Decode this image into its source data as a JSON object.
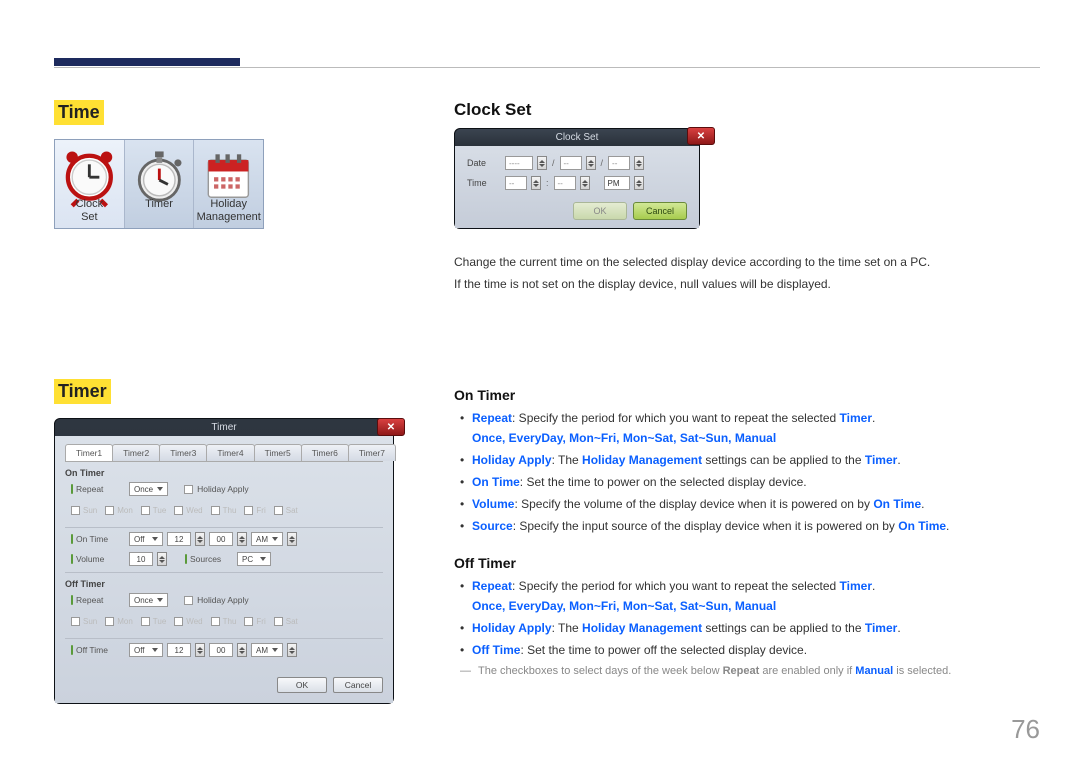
{
  "page_number": "76",
  "bold": {
    "repeat": "Repeat",
    "manual": "Manual"
  },
  "left": {
    "time_heading": "Time",
    "timer_heading": "Timer",
    "time_panel": {
      "clock_set": "Clock\nSet",
      "timer": "Timer",
      "holiday": "Holiday\nManagement"
    }
  },
  "clock_set": {
    "heading": "Clock Set",
    "dialog_title": "Clock Set",
    "date_label": "Date",
    "time_label": "Time",
    "date_placeholder": "----",
    "month_placeholder": "--",
    "day_placeholder": "--",
    "hour_placeholder": "--",
    "minute_placeholder": "--",
    "ampm": "PM",
    "ok": "OK",
    "cancel": "Cancel",
    "desc1": "Change the current time on the selected display device according to the time set on a PC.",
    "desc2": "If the time is not set on the display device, null values will be displayed."
  },
  "timer_dialog": {
    "title": "Timer",
    "tabs": [
      "Timer1",
      "Timer2",
      "Timer3",
      "Timer4",
      "Timer5",
      "Timer6",
      "Timer7"
    ],
    "on_timer_label": "On Timer",
    "off_timer_label": "Off Timer",
    "repeat_label": "Repeat",
    "repeat_value": "Once",
    "holiday_apply_label": "Holiday Apply",
    "days": [
      "Sun",
      "Mon",
      "Tue",
      "Wed",
      "Thu",
      "Fri",
      "Sat"
    ],
    "on_time_label": "On Time",
    "off_time_label": "Off Time",
    "on_time_value": "Off",
    "hour": "12",
    "minute": "00",
    "ampm": "AM",
    "volume_label": "Volume",
    "volume_value": "10",
    "source_label": "Sources",
    "source_value": "PC",
    "ok": "OK",
    "cancel": "Cancel"
  },
  "on_timer": {
    "heading": "On Timer",
    "b1_pre": ": Specify the period for which you want to repeat the selected ",
    "b1_timer": "Timer",
    "options": "Once, EveryDay, Mon~Fri, Mon~Sat, Sat~Sun, Manual",
    "b2_hl": "Holiday Apply",
    "b2_mid": ": The ",
    "b2_hm": "Holiday Management",
    "b2_post": " settings can be applied to the ",
    "b3_hl": "On Time",
    "b3_text": ": Set the time to power on the selected display device.",
    "b4_hl": "Volume",
    "b4_text": ": Specify the volume of the display device when it is powered on by ",
    "b4_ot": "On Time",
    "b5_hl": "Source",
    "b5_text": ": Specify the input source of the display device when it is powered on by ",
    "b5_ot": "On Time"
  },
  "off_timer": {
    "heading": "Off Timer",
    "b1_pre": ": Specify the period for which you want to repeat the selected ",
    "b1_timer": "Timer",
    "options": "Once, EveryDay, Mon~Fri, Mon~Sat, Sat~Sun, Manual",
    "b2_hl": "Holiday Apply",
    "b2_mid": ": The ",
    "b2_hm": "Holiday Management",
    "b2_post": " settings can be applied to the ",
    "b3_hl": "Off Time",
    "b3_text": ": Set the time to power off the selected display device.",
    "note_pre": "The checkboxes to select days of the week below ",
    "note_mid": " are enabled only if ",
    "note_post": " is selected."
  }
}
